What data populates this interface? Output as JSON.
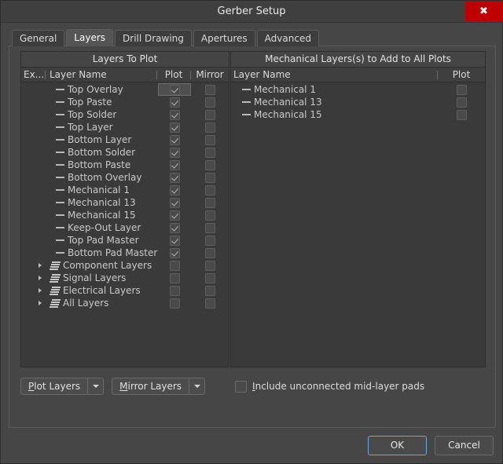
{
  "window": {
    "title": "Gerber Setup",
    "close_label": "✖"
  },
  "tabs": [
    {
      "label": "General",
      "active": false
    },
    {
      "label": "Layers",
      "active": true
    },
    {
      "label": "Drill Drawing",
      "active": false
    },
    {
      "label": "Apertures",
      "active": false
    },
    {
      "label": "Advanced",
      "active": false
    }
  ],
  "left_panel": {
    "caption": "Layers To Plot",
    "columns": {
      "extend": "Ex...",
      "layer_name": "Layer Name",
      "plot": "Plot",
      "mirror": "Mirror"
    },
    "rows": [
      {
        "name": "Top Overlay",
        "kind": "leaf",
        "plot": true,
        "mirror": false,
        "selected": true
      },
      {
        "name": "Top Paste",
        "kind": "leaf",
        "plot": true,
        "mirror": false,
        "selected": false
      },
      {
        "name": "Top Solder",
        "kind": "leaf",
        "plot": true,
        "mirror": false,
        "selected": false
      },
      {
        "name": "Top Layer",
        "kind": "leaf",
        "plot": true,
        "mirror": false,
        "selected": false
      },
      {
        "name": "Bottom Layer",
        "kind": "leaf",
        "plot": true,
        "mirror": false,
        "selected": false
      },
      {
        "name": "Bottom Solder",
        "kind": "leaf",
        "plot": true,
        "mirror": false,
        "selected": false
      },
      {
        "name": "Bottom Paste",
        "kind": "leaf",
        "plot": true,
        "mirror": false,
        "selected": false
      },
      {
        "name": "Bottom Overlay",
        "kind": "leaf",
        "plot": true,
        "mirror": false,
        "selected": false
      },
      {
        "name": "Mechanical 1",
        "kind": "leaf",
        "plot": true,
        "mirror": false,
        "selected": false
      },
      {
        "name": "Mechanical 13",
        "kind": "leaf",
        "plot": true,
        "mirror": false,
        "selected": false
      },
      {
        "name": "Mechanical 15",
        "kind": "leaf",
        "plot": true,
        "mirror": false,
        "selected": false
      },
      {
        "name": "Keep-Out Layer",
        "kind": "leaf",
        "plot": true,
        "mirror": false,
        "selected": false
      },
      {
        "name": "Top Pad Master",
        "kind": "leaf",
        "plot": true,
        "mirror": false,
        "selected": false
      },
      {
        "name": "Bottom Pad Master",
        "kind": "leaf",
        "plot": true,
        "mirror": false,
        "selected": false
      },
      {
        "name": "Component Layers",
        "kind": "group",
        "plot": false,
        "mirror": false,
        "selected": false
      },
      {
        "name": "Signal Layers",
        "kind": "group",
        "plot": false,
        "mirror": false,
        "selected": false
      },
      {
        "name": "Electrical Layers",
        "kind": "group",
        "plot": false,
        "mirror": false,
        "selected": false
      },
      {
        "name": "All Layers",
        "kind": "group",
        "plot": false,
        "mirror": false,
        "selected": false
      }
    ]
  },
  "right_panel": {
    "caption": "Mechanical Layers(s) to Add to All Plots",
    "columns": {
      "layer_name": "Layer Name",
      "plot": "Plot"
    },
    "rows": [
      {
        "name": "Mechanical 1",
        "kind": "leaf",
        "plot": false
      },
      {
        "name": "Mechanical 13",
        "kind": "leaf",
        "plot": false
      },
      {
        "name": "Mechanical 15",
        "kind": "leaf",
        "plot": false
      }
    ]
  },
  "bottom_controls": {
    "plot_layers": {
      "label": "Plot Layers",
      "mnemonic": "P"
    },
    "mirror_layers": {
      "label": "Mirror Layers",
      "mnemonic": "M"
    },
    "include_unconnected": {
      "label": "Include unconnected mid-layer pads",
      "mnemonic": "I",
      "checked": false
    }
  },
  "footer": {
    "ok_label": "OK",
    "cancel_label": "Cancel"
  },
  "colors": {
    "accent_close": "#c00000",
    "focus_border": "#6fa8dc",
    "window_bg": "#464646",
    "panel_bg": "#3a3a3a"
  }
}
